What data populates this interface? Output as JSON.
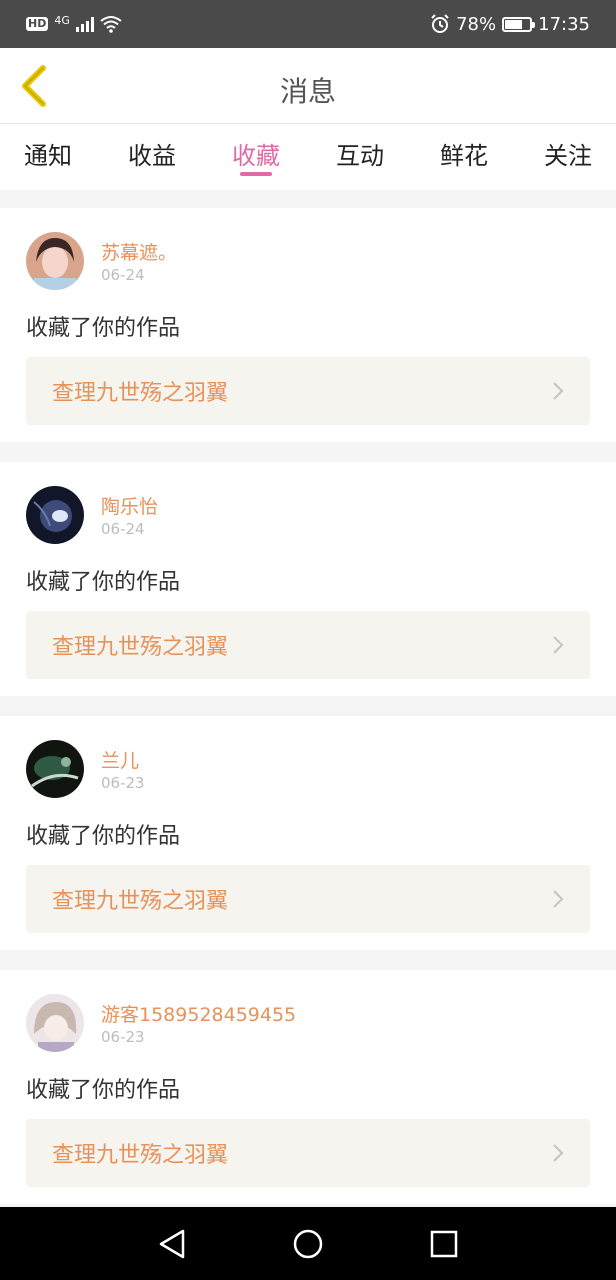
{
  "status_bar": {
    "hd": "HD",
    "network": "4G",
    "battery_percent": "78%",
    "battery_level": 0.78,
    "time": "17:35",
    "icons": [
      "hd-icon",
      "signal-icon",
      "wifi-icon",
      "alarm-icon",
      "battery-icon"
    ]
  },
  "header": {
    "title": "消息",
    "back_icon": "chevron-left-icon",
    "accent_color": "#e8c600"
  },
  "tabs": [
    {
      "label": "通知",
      "active": false
    },
    {
      "label": "收益",
      "active": false
    },
    {
      "label": "收藏",
      "active": true
    },
    {
      "label": "互动",
      "active": false
    },
    {
      "label": "鲜花",
      "active": false
    },
    {
      "label": "关注",
      "active": false
    }
  ],
  "colors": {
    "active_tab": "#e06aa5",
    "username": "#e8925a",
    "work_title": "#e8925a"
  },
  "notifications": [
    {
      "username": "苏幕遮。",
      "date": "06-24",
      "action": "收藏了你的作品",
      "work_title": "查理九世殇之羽翼"
    },
    {
      "username": "陶乐怡",
      "date": "06-24",
      "action": "收藏了你的作品",
      "work_title": "查理九世殇之羽翼"
    },
    {
      "username": "兰儿",
      "date": "06-23",
      "action": "收藏了你的作品",
      "work_title": "查理九世殇之羽翼"
    },
    {
      "username": "游客1589528459455",
      "date": "06-23",
      "action": "收藏了你的作品",
      "work_title": "查理九世殇之羽翼"
    }
  ],
  "nav_bar": {
    "icons": [
      "back-triangle-icon",
      "home-circle-icon",
      "recents-square-icon"
    ]
  }
}
